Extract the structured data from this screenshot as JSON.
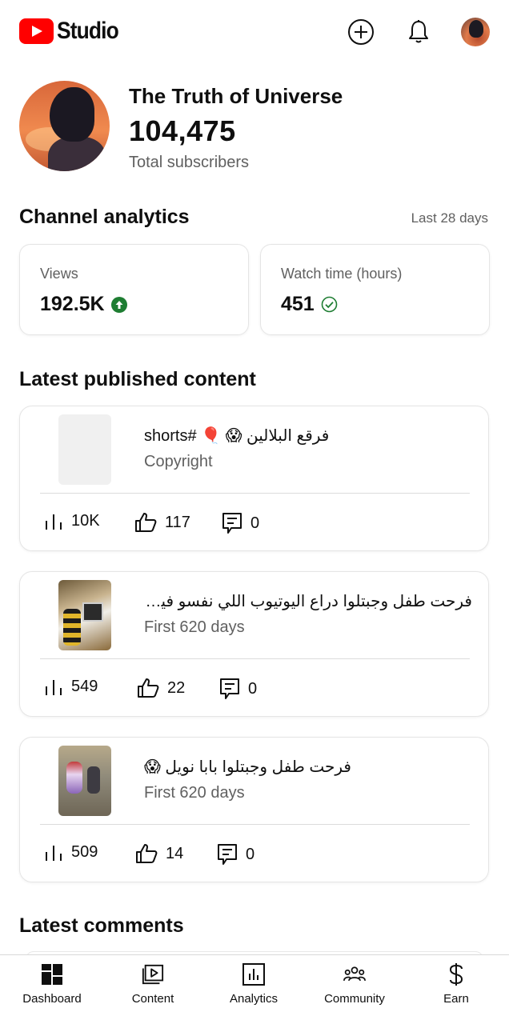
{
  "header": {
    "logo_text": "Studio",
    "icons": [
      "create-icon",
      "notifications-bell-icon",
      "account-avatar"
    ]
  },
  "channel": {
    "name": "The Truth of Universe",
    "subscribers": "104,475",
    "subscribers_label": "Total subscribers"
  },
  "analytics": {
    "title": "Channel analytics",
    "range": "Last 28 days",
    "cards": [
      {
        "label": "Views",
        "value": "192.5K",
        "status_icon": "arrow-up-circle-icon",
        "status_color": "#1e7d32"
      },
      {
        "label": "Watch time (hours)",
        "value": "451",
        "status_icon": "check-circle-icon",
        "status_color": "#1e7d32"
      }
    ]
  },
  "latest_content": {
    "title": "Latest published content",
    "items": [
      {
        "title": "فرقع البلالين 😱 🎈 #shorts",
        "subtitle": "Copyright",
        "views": "10K",
        "likes": "117",
        "comments": "0"
      },
      {
        "title": "فرحت طفل وجبتلوا دراع اليوتيوب اللي نفسو فيه...",
        "subtitle": "First 620 days",
        "views": "549",
        "likes": "22",
        "comments": "0"
      },
      {
        "title": "فرحت طفل وجبتلوا بابا نويل 😱",
        "subtitle": "First 620 days",
        "views": "509",
        "likes": "14",
        "comments": "0"
      }
    ]
  },
  "latest_comments": {
    "title": "Latest comments"
  },
  "bottom_nav": {
    "items": [
      {
        "label": "Dashboard",
        "icon": "dashboard-icon"
      },
      {
        "label": "Content",
        "icon": "content-icon"
      },
      {
        "label": "Analytics",
        "icon": "analytics-icon"
      },
      {
        "label": "Community",
        "icon": "community-icon"
      },
      {
        "label": "Earn",
        "icon": "dollar-icon"
      }
    ]
  }
}
